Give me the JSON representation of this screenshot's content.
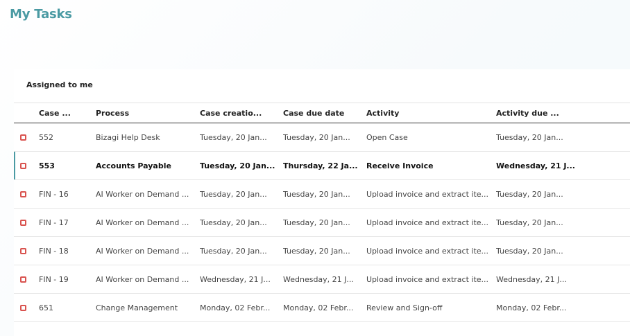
{
  "page": {
    "title": "My Tasks"
  },
  "panel": {
    "subtitle": "Assigned to me"
  },
  "colors": {
    "title": "#4a9aa3",
    "status_indicator": "#d9534f",
    "selected_bar": "#4a9aa3"
  },
  "table": {
    "columns": [
      "Case ...",
      "Process",
      "Case creatio...",
      "Case due date",
      "Activity",
      "Activity due ..."
    ],
    "rows": [
      {
        "case": "552",
        "process": "Bizagi Help Desk",
        "created": "Tuesday, 20 Jan...",
        "due": "Tuesday, 20 Jan...",
        "activity": "Open Case",
        "activity_due": "Tuesday, 20 Jan...",
        "selected": false
      },
      {
        "case": "553",
        "process": "Accounts Payable",
        "created": "Tuesday, 20 Jan...",
        "due": "Thursday, 22 Ja...",
        "activity": "Receive Invoice",
        "activity_due": "Wednesday, 21 J...",
        "selected": true
      },
      {
        "case": "FIN - 16",
        "process": "AI Worker on Demand ...",
        "created": "Tuesday, 20 Jan...",
        "due": "Tuesday, 20 Jan...",
        "activity": "Upload invoice and extract ite...",
        "activity_due": "Tuesday, 20 Jan...",
        "selected": false
      },
      {
        "case": "FIN - 17",
        "process": "AI Worker on Demand ...",
        "created": "Tuesday, 20 Jan...",
        "due": "Tuesday, 20 Jan...",
        "activity": "Upload invoice and extract ite...",
        "activity_due": "Tuesday, 20 Jan...",
        "selected": false
      },
      {
        "case": "FIN - 18",
        "process": "AI Worker on Demand ...",
        "created": "Tuesday, 20 Jan...",
        "due": "Tuesday, 20 Jan...",
        "activity": "Upload invoice and extract ite...",
        "activity_due": "Tuesday, 20 Jan...",
        "selected": false
      },
      {
        "case": "FIN - 19",
        "process": "AI Worker on Demand ...",
        "created": "Wednesday, 21 J...",
        "due": "Wednesday, 21 J...",
        "activity": "Upload invoice and extract ite...",
        "activity_due": "Wednesday, 21 J...",
        "selected": false
      },
      {
        "case": "651",
        "process": "Change Management",
        "created": "Monday, 02 Febr...",
        "due": "Monday, 02 Febr...",
        "activity": "Review and Sign-off",
        "activity_due": "Monday, 02 Febr...",
        "selected": false
      }
    ]
  }
}
